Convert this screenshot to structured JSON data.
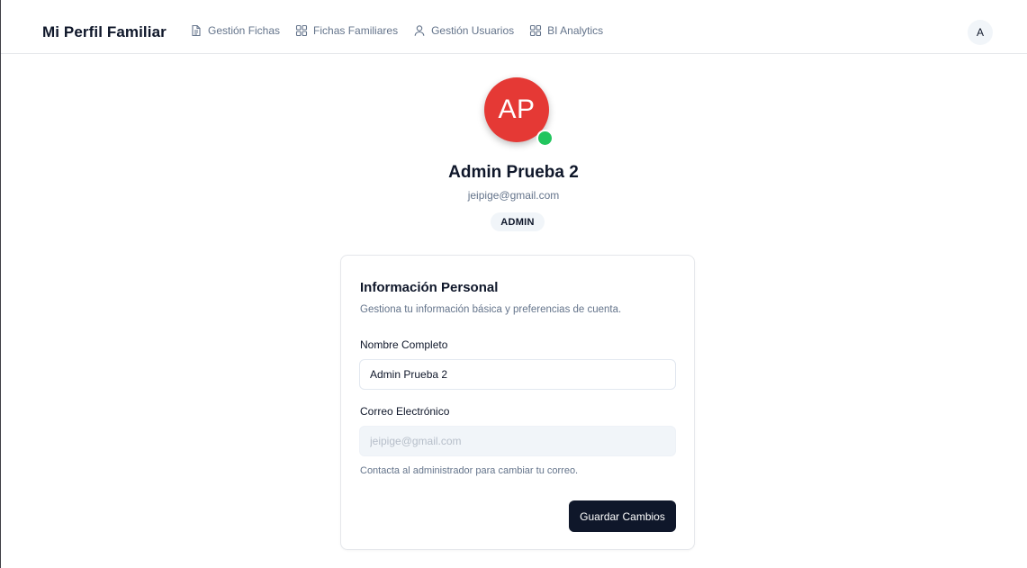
{
  "header": {
    "brand": "Mi Perfil Familiar",
    "nav": [
      {
        "label": "Gestión Fichas",
        "icon": "file-text-icon"
      },
      {
        "label": "Fichas Familiares",
        "icon": "grid-icon"
      },
      {
        "label": "Gestión Usuarios",
        "icon": "user-icon"
      },
      {
        "label": "BI Analytics",
        "icon": "grid-icon"
      }
    ],
    "avatar_initial": "A"
  },
  "profile": {
    "initials": "AP",
    "name": "Admin Prueba 2",
    "email": "jeipige@gmail.com",
    "role": "ADMIN",
    "avatar_color": "#e53935",
    "status_color": "#22c55e"
  },
  "card": {
    "title": "Información Personal",
    "description": "Gestiona tu información básica y preferencias de cuenta.",
    "name_label": "Nombre Completo",
    "name_value": "Admin Prueba 2",
    "email_label": "Correo Electrónico",
    "email_placeholder": "jeipige@gmail.com",
    "email_help": "Contacta al administrador para cambiar tu correo.",
    "save_label": "Guardar Cambios"
  }
}
